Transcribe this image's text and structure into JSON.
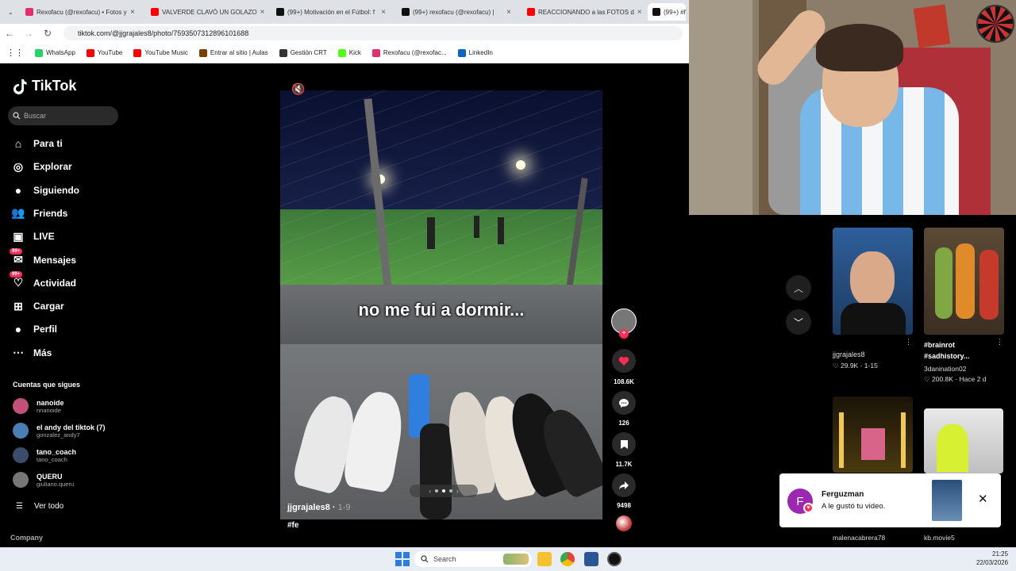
{
  "browser": {
    "tabs": [
      {
        "label": "Rexofacu (@rexofacu) • Fotos y",
        "color": "#e1306c"
      },
      {
        "label": "VALVERDE CLAVÓ UN GOLAZO",
        "color": "#ff0000"
      },
      {
        "label": "(99+) Motivación en el Fútbol: f",
        "color": "#111111"
      },
      {
        "label": "(99+) rexofacu (@rexofacu) |",
        "color": "#111111"
      },
      {
        "label": "REACCIONANDO a las FOTOS d",
        "color": "#ff0000"
      },
      {
        "label": "(99+) #f",
        "color": "#111111"
      }
    ],
    "url": "tiktok.com/@jjgrajales8/photo/7593507312896101688",
    "bookmarks": [
      {
        "label": "WhatsApp",
        "color": "#25d366"
      },
      {
        "label": "YouTube",
        "color": "#ff0000"
      },
      {
        "label": "YouTube Music",
        "color": "#ff0000"
      },
      {
        "label": "Entrar al sitio | Aulas",
        "color": "#7b3f00"
      },
      {
        "label": "Gestión CRT",
        "color": "#333333"
      },
      {
        "label": "Kick",
        "color": "#53fc18"
      },
      {
        "label": "Rexofacu (@rexofac...",
        "color": "#e1306c"
      },
      {
        "label": "LinkedIn",
        "color": "#0a66c2"
      }
    ]
  },
  "tiktok": {
    "logo": "TikTok",
    "search_placeholder": "Buscar",
    "nav": [
      {
        "label": "Para ti",
        "icon": "home-icon"
      },
      {
        "label": "Explorar",
        "icon": "compass-icon"
      },
      {
        "label": "Siguiendo",
        "icon": "following-icon"
      },
      {
        "label": "Friends",
        "icon": "friends-icon"
      },
      {
        "label": "LIVE",
        "icon": "live-icon"
      },
      {
        "label": "Mensajes",
        "icon": "messages-icon",
        "badge": "99+"
      },
      {
        "label": "Actividad",
        "icon": "activity-icon",
        "badge": "99+"
      },
      {
        "label": "Cargar",
        "icon": "upload-icon"
      },
      {
        "label": "Perfil",
        "icon": "profile-icon"
      },
      {
        "label": "Más",
        "icon": "more-icon"
      }
    ],
    "following_title": "Cuentas que sigues",
    "following": [
      {
        "name": "nanoide",
        "handle": "nnanoide",
        "color": "#c2507a"
      },
      {
        "name": "el andy del tiktok (7)",
        "handle": "gonzalez_andy7",
        "color": "#4a7fb5"
      },
      {
        "name": "tano_coach",
        "handle": "tano_coach",
        "color": "#3b4c6b"
      },
      {
        "name": "QUERU",
        "handle": "giuliano.queru",
        "color": "#777777"
      }
    ],
    "see_all": "Ver todo",
    "company": "Company"
  },
  "post": {
    "caption": "no me fui a dormir...",
    "author": "jjgrajales8",
    "date": "1-9",
    "hashtag": "#fe",
    "likes": "108.6K",
    "comments": "126",
    "saves": "11.7K",
    "shares": "9498"
  },
  "related": [
    {
      "title": "",
      "author": "jjgrajales8",
      "likes": "29.9K",
      "date": "1-15"
    },
    {
      "title": "#brainrot #sadhistory...",
      "author": "3danination02",
      "likes": "200.8K",
      "date": "Hace 2 d"
    },
    {
      "author": "malenacabrera78"
    },
    {
      "author": "kb.movie5"
    }
  ],
  "notification": {
    "user": "Ferguzman",
    "initial": "F",
    "text": "A le gustó tu video."
  },
  "taskbar": {
    "search": "Search",
    "time": "21:25",
    "date": "22/03/2026"
  }
}
